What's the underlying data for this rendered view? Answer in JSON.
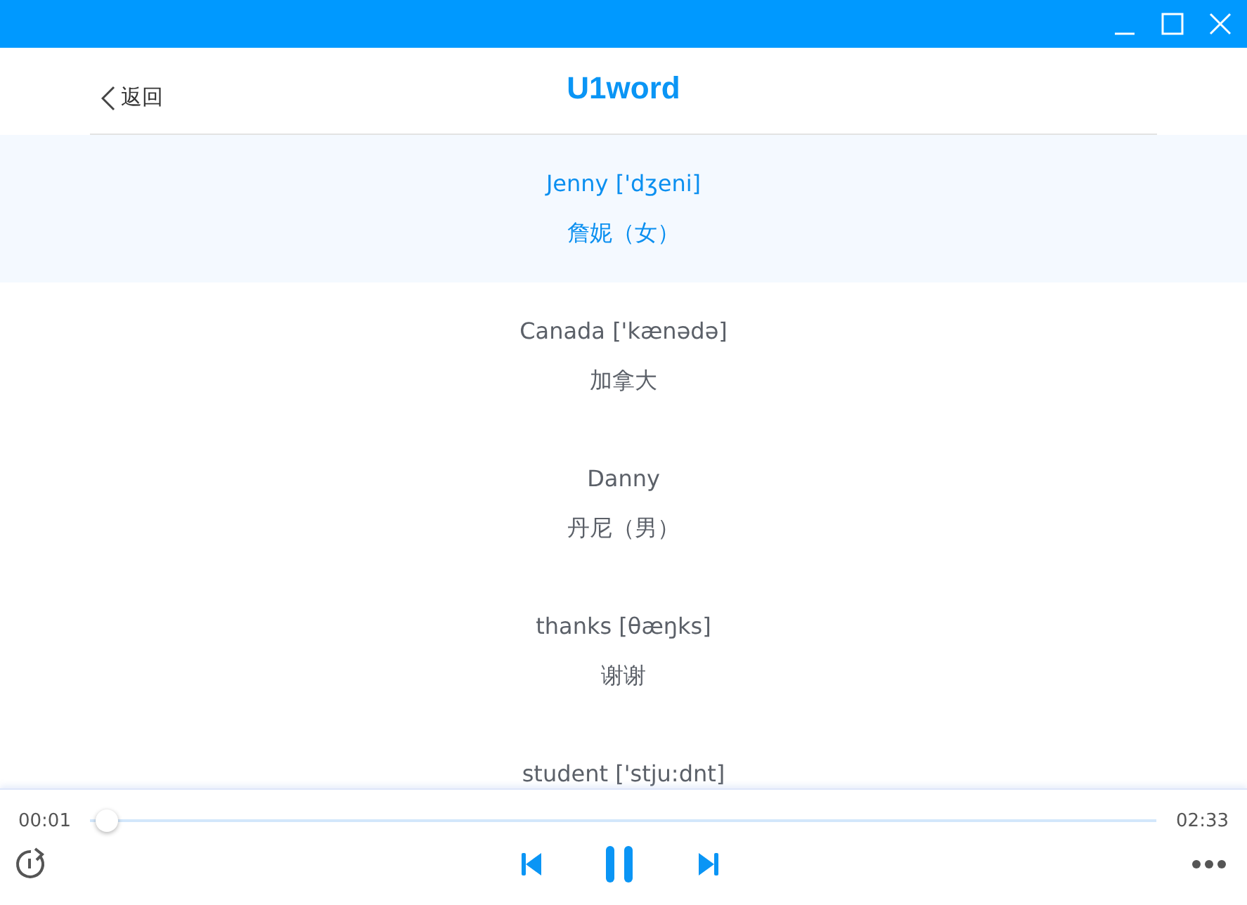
{
  "header": {
    "back": "返回",
    "title": "U1word"
  },
  "words": [
    {
      "word": "Jenny ['dʒeni]",
      "meaning": "詹妮（女）",
      "selected": true
    },
    {
      "word": "Canada ['kænədə]",
      "meaning": "加拿大",
      "selected": false
    },
    {
      "word": "Danny",
      "meaning": "丹尼（男）",
      "selected": false
    },
    {
      "word": "thanks [θæŋks]",
      "meaning": "谢谢",
      "selected": false
    },
    {
      "word": "student ['stju:dnt]",
      "selected": false
    }
  ],
  "player": {
    "elapsed": "00:01",
    "total": "02:33",
    "level": 0.01,
    "playing": true
  }
}
